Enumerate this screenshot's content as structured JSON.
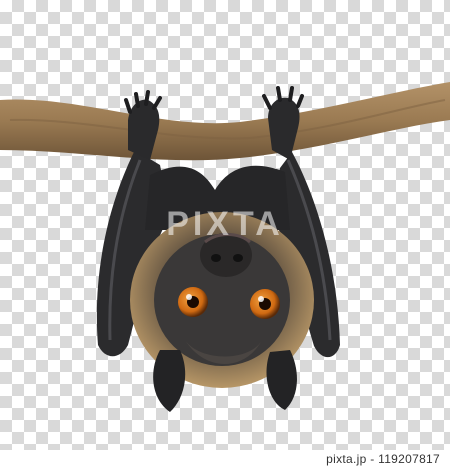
{
  "image": {
    "subject": "fruit bat hanging upside down from branch",
    "background": "transparent checkerboard",
    "watermark_text": "PIXTA",
    "colors": {
      "branch": "#9a7a52",
      "wing": "#2b2b2d",
      "fur": "#c8a46e",
      "face": "#3a3838",
      "eye": "#e07a1a"
    }
  },
  "footer": {
    "id_label": "pixta.jp - 119207817"
  }
}
